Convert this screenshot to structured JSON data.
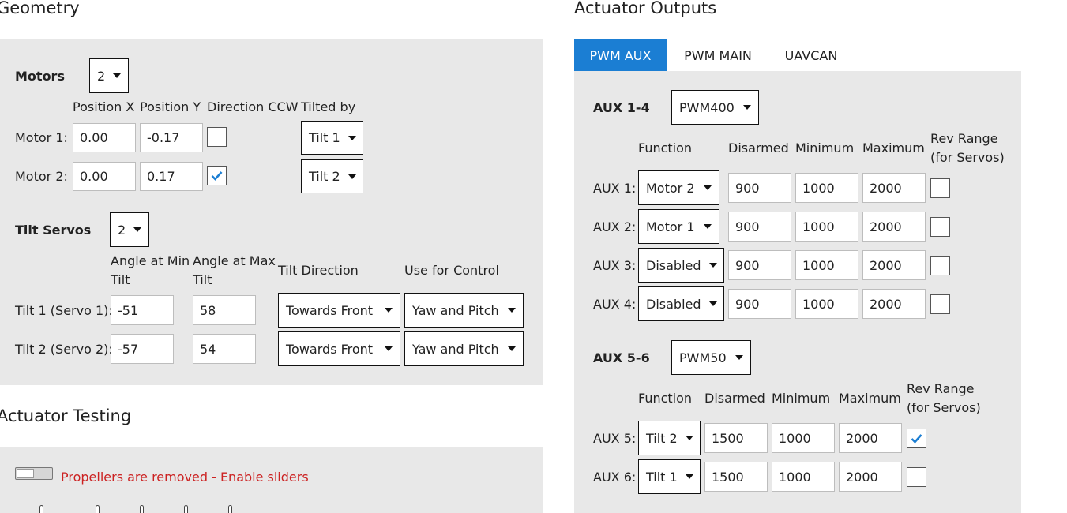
{
  "geometry": {
    "title": "Geometry",
    "motors": {
      "label": "Motors",
      "count": "2",
      "headers": {
        "pos_x": "Position X",
        "pos_y": "Position Y",
        "dir_ccw": "Direction CCW",
        "tilted_by": "Tilted by"
      },
      "rows": [
        {
          "label": "Motor 1:",
          "x": "0.00",
          "y": "-0.17",
          "ccw": false,
          "tilt": "Tilt 1"
        },
        {
          "label": "Motor 2:",
          "x": "0.00",
          "y": "0.17",
          "ccw": true,
          "tilt": "Tilt 2"
        }
      ]
    },
    "tilt_servos": {
      "label": "Tilt Servos",
      "count": "2",
      "headers": {
        "angle_min_1": "Angle at Min",
        "angle_min_2": "Tilt",
        "angle_max_1": "Angle at Max",
        "angle_max_2": "Tilt",
        "direction": "Tilt Direction",
        "use_for": "Use for Control"
      },
      "rows": [
        {
          "label": "Tilt 1 (Servo 1):",
          "min": "-51",
          "max": "58",
          "direction": "Towards Front",
          "use": "Yaw and Pitch"
        },
        {
          "label": "Tilt 2 (Servo 2):",
          "min": "-57",
          "max": "54",
          "direction": "Towards Front",
          "use": "Yaw and Pitch"
        }
      ]
    }
  },
  "actuator_testing": {
    "title": "Actuator Testing",
    "warning": "Propellers are removed - Enable sliders",
    "toggle_on": false
  },
  "actuator_outputs": {
    "title": "Actuator Outputs",
    "tabs": [
      {
        "label": "PWM AUX",
        "active": true
      },
      {
        "label": "PWM MAIN",
        "active": false
      },
      {
        "label": "UAVCAN",
        "active": false
      }
    ],
    "headers": {
      "function": "Function",
      "disarmed": "Disarmed",
      "minimum": "Minimum",
      "maximum": "Maximum",
      "rev_range_1": "Rev Range",
      "rev_range_2": "(for Servos)"
    },
    "groups": [
      {
        "label": "AUX 1-4",
        "rate": "PWM400",
        "rows": [
          {
            "label": "AUX 1:",
            "function": "Motor 2",
            "disarmed": "900",
            "min": "1000",
            "max": "2000",
            "rev": false
          },
          {
            "label": "AUX 2:",
            "function": "Motor 1",
            "disarmed": "900",
            "min": "1000",
            "max": "2000",
            "rev": false
          },
          {
            "label": "AUX 3:",
            "function": "Disabled",
            "disarmed": "900",
            "min": "1000",
            "max": "2000",
            "rev": false
          },
          {
            "label": "AUX 4:",
            "function": "Disabled",
            "disarmed": "900",
            "min": "1000",
            "max": "2000",
            "rev": false
          }
        ]
      },
      {
        "label": "AUX 5-6",
        "rate": "PWM50",
        "rows": [
          {
            "label": "AUX 5:",
            "function": "Tilt 2",
            "disarmed": "1500",
            "min": "1000",
            "max": "2000",
            "rev": true
          },
          {
            "label": "AUX 6:",
            "function": "Tilt 1",
            "disarmed": "1500",
            "min": "1000",
            "max": "2000",
            "rev": false
          }
        ]
      }
    ]
  },
  "colors": {
    "accent": "#1b7ed3",
    "panel": "#e8e8e8",
    "warning": "#cc2222",
    "check": "#1b7ed3"
  },
  "icons": {
    "dropdown": "caret-down-icon",
    "check": "checkmark-icon"
  }
}
